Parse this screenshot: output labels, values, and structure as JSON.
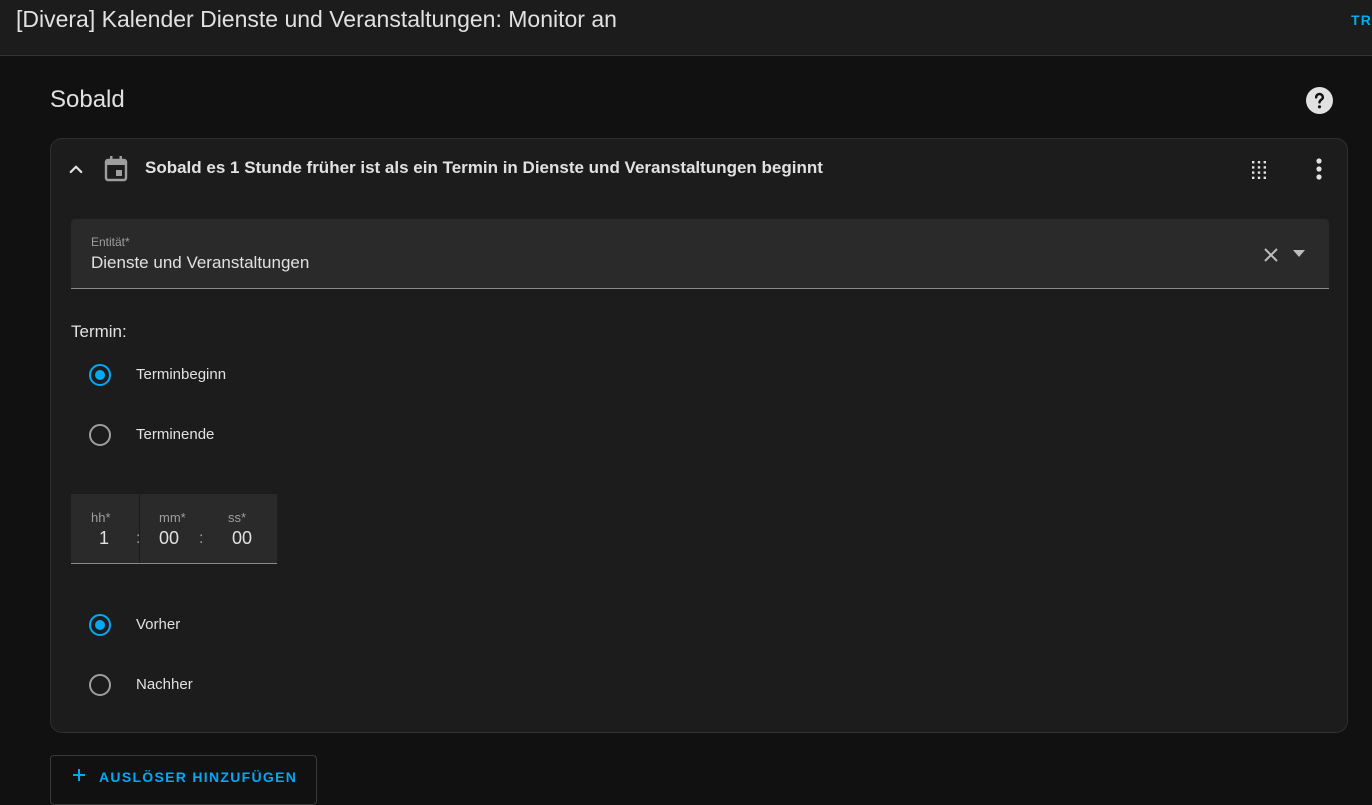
{
  "header": {
    "title": "[Divera] Kalender Dienste und Veranstaltungen: Monitor an",
    "action_label": "TR"
  },
  "section": {
    "title": "Sobald"
  },
  "icons": {
    "help": "help-circle-icon",
    "collapse": "chevron-up-icon",
    "calendar": "calendar-icon",
    "drag": "drag-handle-icon",
    "menu": "more-vert-icon",
    "clear": "close-icon",
    "dropdown": "dropdown-arrow-icon",
    "add": "plus-icon"
  },
  "trigger": {
    "summary": "Sobald es 1 Stunde früher ist als ein Termin in Dienste und Veranstaltungen beginnt",
    "entity": {
      "label": "Entität*",
      "value": "Dienste und Veranstaltungen"
    },
    "event_label": "Termin:",
    "event_options": [
      {
        "label": "Terminbeginn",
        "checked": true
      },
      {
        "label": "Terminende",
        "checked": false
      }
    ],
    "offset": {
      "hours_label": "hh*",
      "hours": "1",
      "minutes_label": "mm*",
      "minutes": "00",
      "seconds_label": "ss*",
      "seconds": "00",
      "separator": ":"
    },
    "direction_options": [
      {
        "label": "Vorher",
        "checked": true
      },
      {
        "label": "Nachher",
        "checked": false
      }
    ]
  },
  "add_trigger_label": "AUSLÖSER HINZUFÜGEN",
  "colors": {
    "accent": "#03a9f4",
    "background": "#111111",
    "card": "#1c1c1c"
  }
}
